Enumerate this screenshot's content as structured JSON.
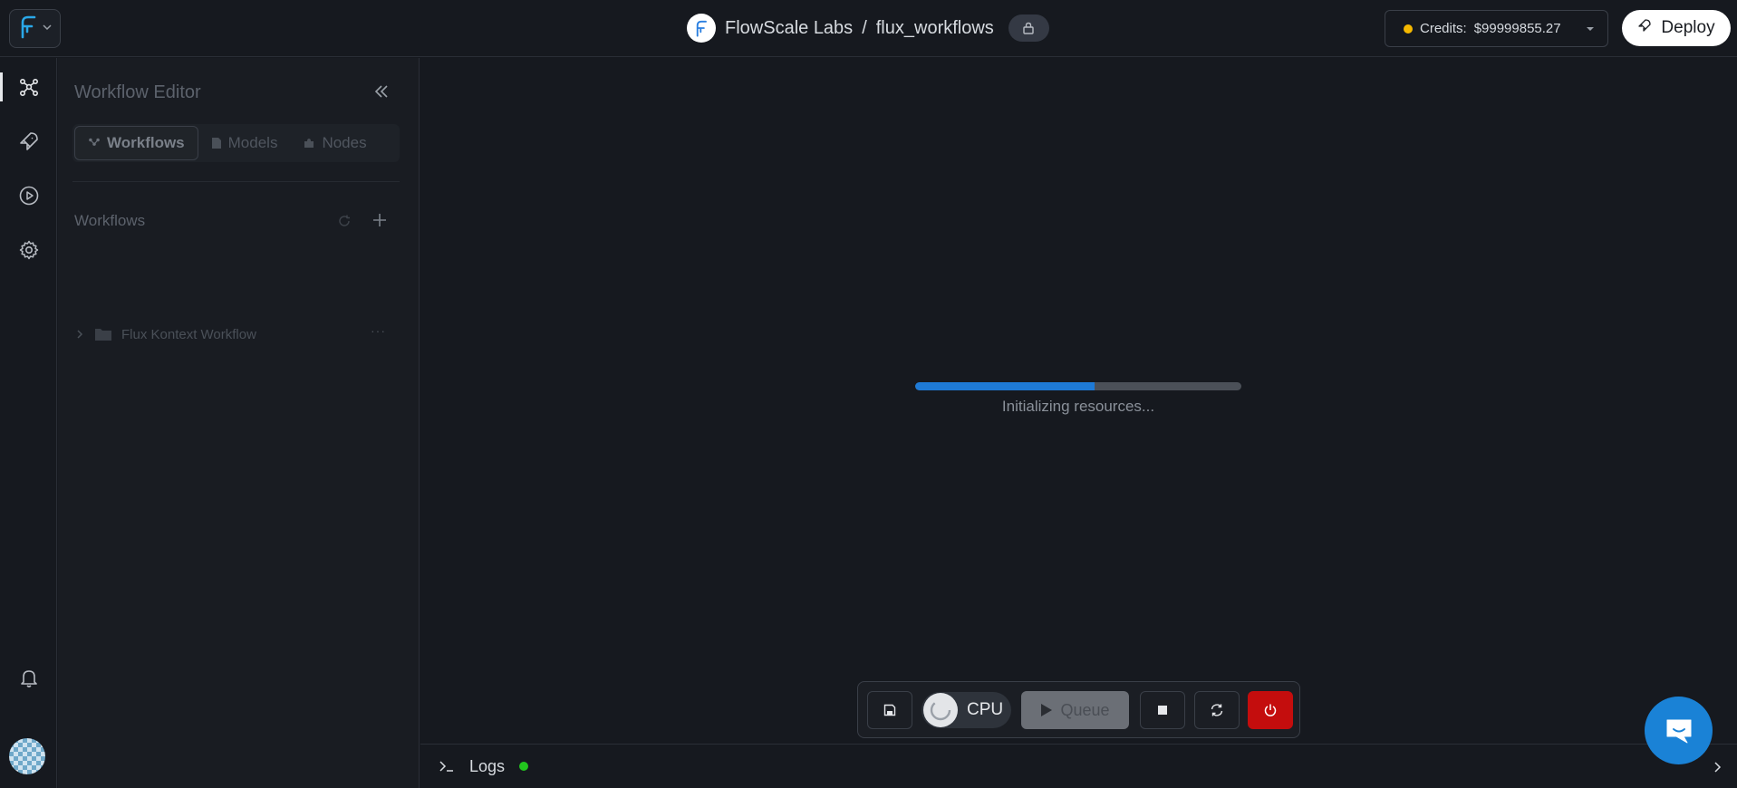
{
  "header": {
    "org_name": "FlowScale Labs",
    "separator": "/",
    "project_name": "flux_workflows",
    "credits_label": "Credits:",
    "credits_amount": "$99999855.27",
    "deploy_label": "Deploy"
  },
  "sidebar": {
    "title": "Workflow Editor",
    "tabs": [
      {
        "label": "Workflows",
        "active": true
      },
      {
        "label": "Models",
        "active": false
      },
      {
        "label": "Nodes",
        "active": false
      }
    ],
    "section_title": "Workflows",
    "tree": [
      {
        "label": "Flux Kontext Workflow",
        "more": "···"
      }
    ]
  },
  "canvas": {
    "progress_fraction": 0.55,
    "status_text": "Initializing resources..."
  },
  "toolbar": {
    "cpu_label": "CPU",
    "queue_label": "Queue"
  },
  "logs": {
    "label": "Logs",
    "status_color": "#22c51e"
  },
  "colors": {
    "accent": "#1e7ad6",
    "danger": "#c40d0d",
    "credits_dot": "#f5b800"
  }
}
